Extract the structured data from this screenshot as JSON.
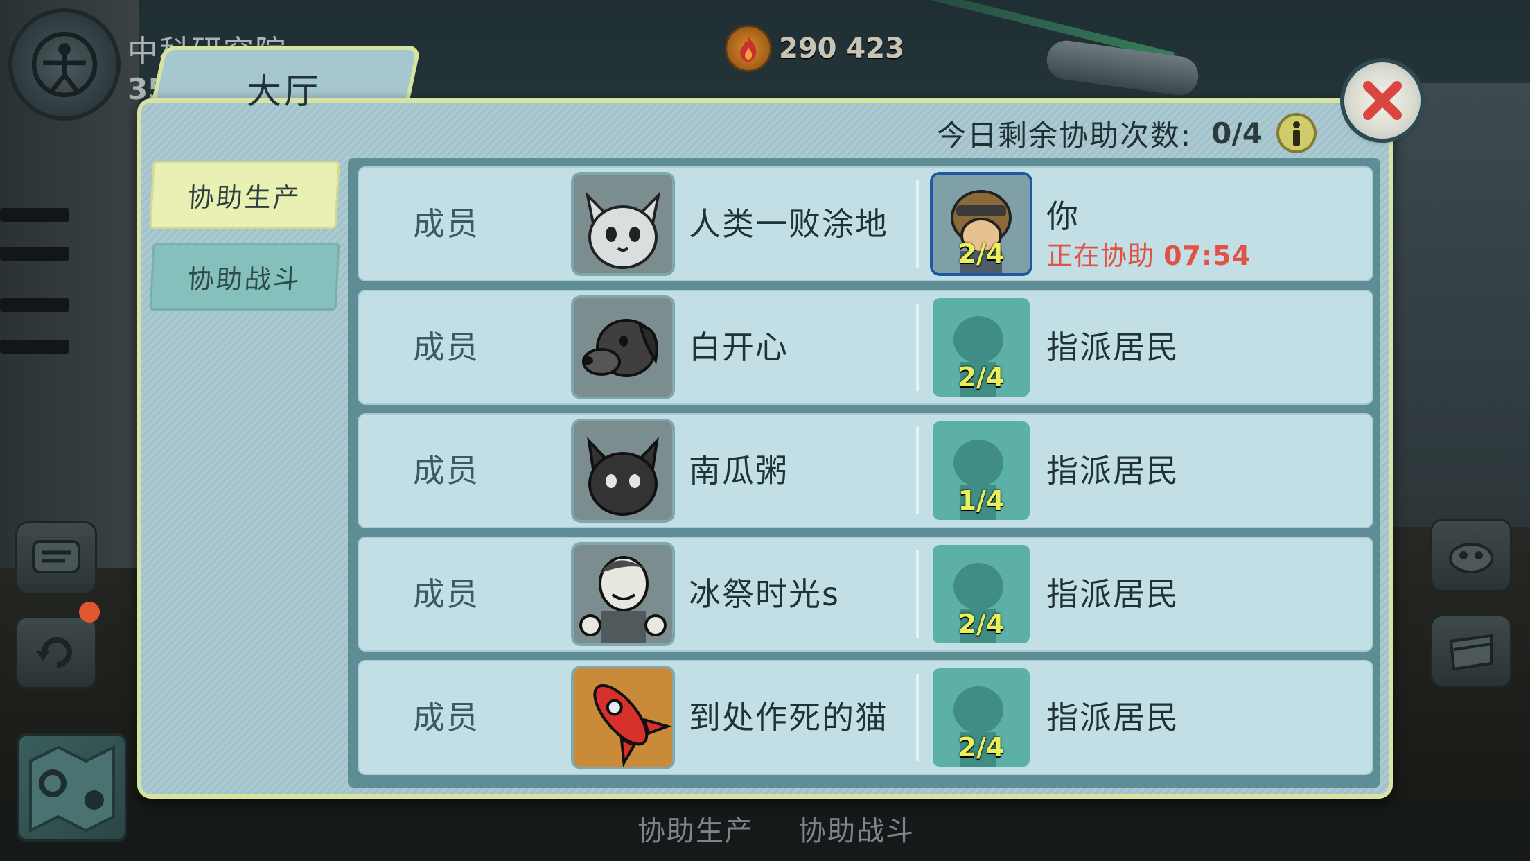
{
  "hud": {
    "vault_name": "中科研究院",
    "vault_population": "35",
    "currency_value": "290 423",
    "currency_icon": "fire-icon"
  },
  "dialog": {
    "title": "大厅",
    "remaining_label": "今日剩余协助次数:",
    "remaining_value": "0/4",
    "info_icon": "info-icon",
    "close_icon": "close-icon",
    "tabs": [
      {
        "label": "协助生产",
        "active": true
      },
      {
        "label": "协助战斗",
        "active": false
      }
    ],
    "rows": [
      {
        "role": "成员",
        "name": "人类一败涂地",
        "avatar": "gray-cat",
        "assist_count": "2/4",
        "assist_you": "你",
        "assist_status": "正在协助",
        "assist_time": "07:54"
      },
      {
        "role": "成员",
        "name": "白开心",
        "avatar": "dog",
        "assist_count": "2/4",
        "assist_label": "指派居民"
      },
      {
        "role": "成员",
        "name": "南瓜粥",
        "avatar": "black-cat",
        "assist_count": "1/4",
        "assist_label": "指派居民"
      },
      {
        "role": "成员",
        "name": "冰祭时光s",
        "avatar": "vault-boy",
        "assist_count": "2/4",
        "assist_label": "指派居民"
      },
      {
        "role": "成员",
        "name": "到处作死的猫",
        "avatar": "rocket",
        "assist_count": "2/4",
        "assist_label": "指派居民"
      }
    ]
  },
  "bottom_tabs": [
    "协助生产",
    "协助战斗"
  ],
  "colors": {
    "panel": "#a7c7d0",
    "panel_border": "#d6e3a2",
    "row": "#c3dfe6",
    "active_tab": "#eaf0b4",
    "inactive_tab": "#86c0bc",
    "assist_status": "#e05244",
    "slot_count": "#e9f05a"
  }
}
